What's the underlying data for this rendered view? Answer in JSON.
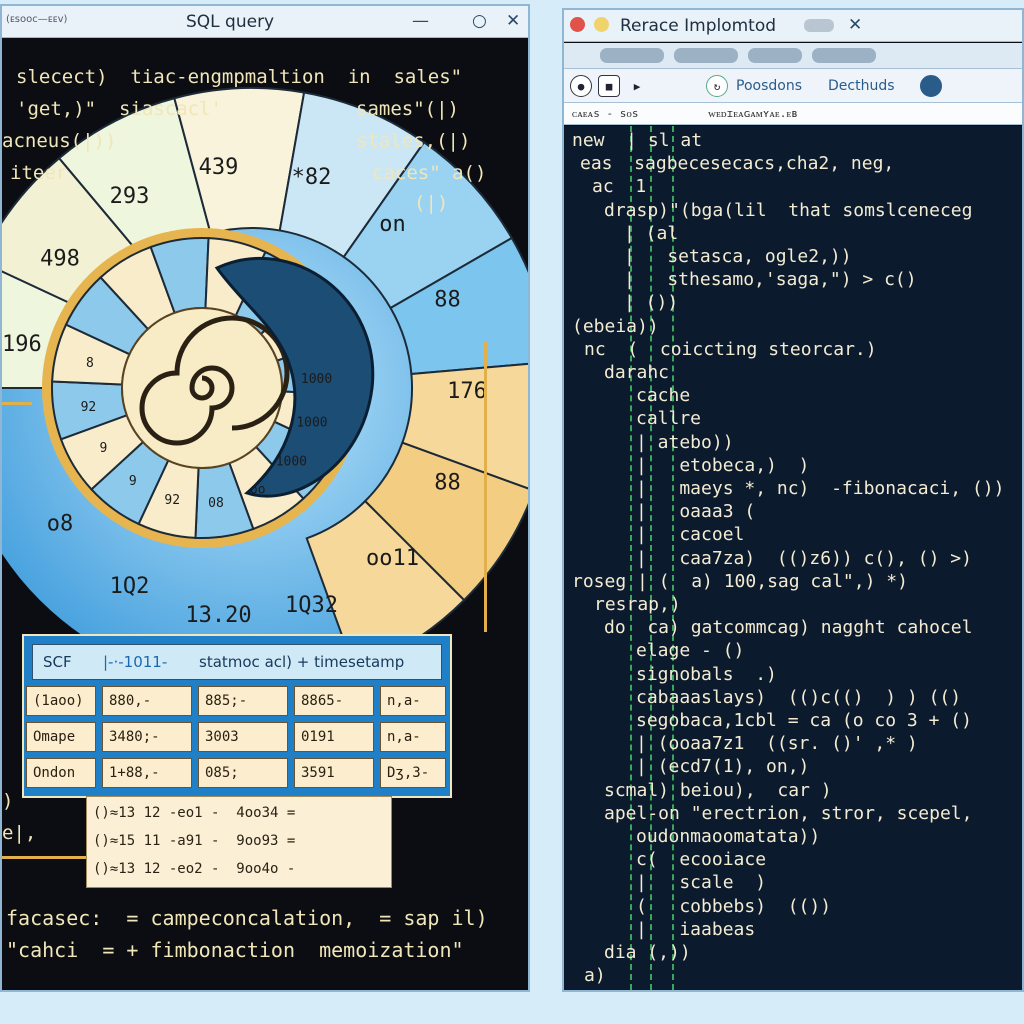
{
  "left_window": {
    "title": "SQL query",
    "title_tag": "(ᴇsᴏᴏᴄ—ᴇᴇᴠ)",
    "controls": {
      "minimize": "—",
      "maximize": "○",
      "close": "✕"
    },
    "code_lines": [
      "slecect)  tiac-engmpmaltion  in  sales\"",
      "'get,)\"  siascacl'",
      "acneus(|))",
      "iteer"
    ],
    "right_column": [
      "sames\"(|)",
      "stales,(|)",
      "caces\" a()",
      "(|)"
    ],
    "spiral": {
      "outer_labels": [
        "196",
        "498",
        "293",
        "439",
        "*82",
        "on",
        "88",
        "176",
        "88",
        "oo11",
        "1Q32",
        "13.20",
        "1Q2",
        "o8"
      ],
      "inner_labels": [
        "1000",
        "1000",
        "1000",
        "oo",
        "08",
        "92",
        "9",
        "9",
        "92",
        "8"
      ]
    },
    "table": {
      "header": [
        "SCF",
        "|-·-1011-",
        "statmoc acl) + timesetamp"
      ],
      "rows": [
        {
          "label": "(1aoo)",
          "cells": [
            "880,-",
            "885;-",
            "8865-",
            "n,a-"
          ]
        },
        {
          "label": "Omape",
          "cells": [
            "3480;-",
            "3003",
            "0191",
            "n,a-"
          ]
        },
        {
          "label": "Ondon",
          "cells": [
            "1+88,-",
            "085;",
            "3591",
            "Dʒ,3-"
          ]
        }
      ]
    },
    "log_lines": [
      "()≈13 12 -eo1 -  4oo34 =",
      "()≈15 11 -a91 -  9oo93 =",
      "()≈13 12 -eo2 -  9oo4o -"
    ],
    "left_edge": [
      ")",
      "e|,"
    ],
    "bottom_lines": [
      "facasec:  = campeconcalation,  = sap il)",
      "\"cahci  = + fimbonaction  memoization\""
    ]
  },
  "right_window": {
    "title": "Rerace Implomtod",
    "close": "✕",
    "toolbar": {
      "buttons": [
        "●",
        "■",
        "▶",
        "↻"
      ],
      "labels": [
        "Poosdons",
        "Decthuds"
      ]
    },
    "address": [
      "ᴄᴀᴇᴀs - sᴏs",
      "ᴡᴇᴅɪᴇᴀɢᴀᴍʏᴀᴇ.ᴇʙ"
    ],
    "code_lines": [
      "new  | sl at",
      "eas  sagbecesecacs,cha2, neg,",
      "ac  1",
      "drasp)\"(bga(lil  that somslceneceg",
      "| (al",
      "|   setasca, ogle2,))",
      "|   sthesamo,'saga,\") > c()",
      "| ())",
      "(ebeia))",
      "nc  (  coiccting steorcar.)",
      "darahc",
      "cache",
      "callre",
      "| atebo))",
      "|   etobeca,)  )",
      "|   maeys *, nc)  -fibonacaci, ())",
      "|   oaaa3 (",
      "|   cacoel",
      "|   caa7za)  (()z6)) c(), () >)",
      "roseg | (  a) 100,sag cal\",) *)",
      "resrap,)",
      "do  ca) gatcommcag) nagght cahocel",
      "elage - ()",
      "signobals  .)",
      "cabaaaslays)  (()c(()  ) ) (()",
      "segobaca,1cbl = ca (o co 3 + ()",
      "| (ooaa7z1  ((sr. ()' ,* )",
      "| (ecd7(1), on,)",
      "scmal) beiou),  car )",
      "apel-on \"erectrion, stror, scepel,",
      "oudonmaoomatata))",
      "c(  ecooiace",
      "|   scale  )",
      "(   cobbebs)  (())",
      "|   iaabeas",
      "dia (,))",
      "a)"
    ]
  }
}
